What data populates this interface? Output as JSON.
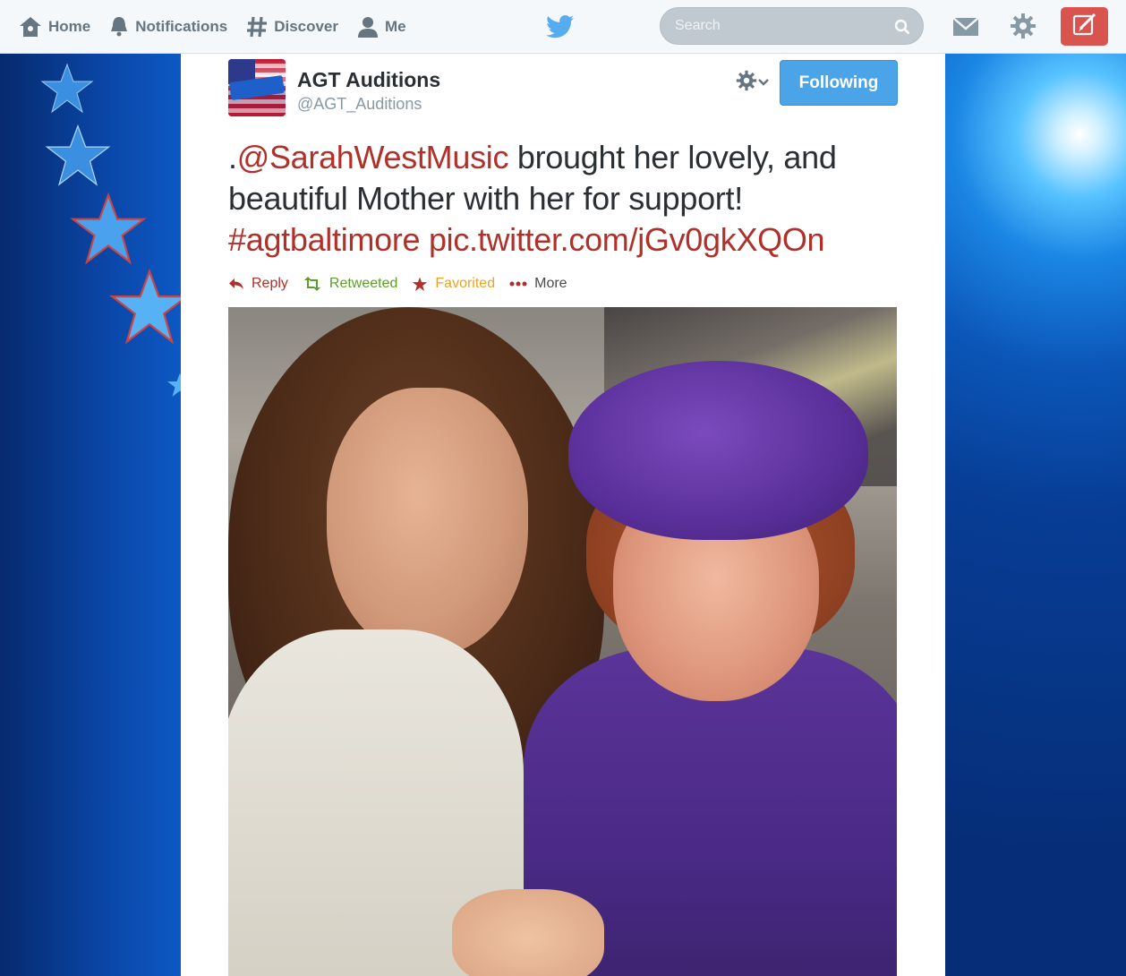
{
  "nav": {
    "home_label": "Home",
    "notifications_label": "Notifications",
    "discover_label": "Discover",
    "me_label": "Me"
  },
  "search": {
    "placeholder": "Search"
  },
  "tweet": {
    "name": "AGT Auditions",
    "handle": "@AGT_Auditions",
    "follow_label": "Following",
    "text_prefix": ".",
    "mention": "@SarahWestMusic",
    "text_body": " brought her lovely, and beautiful Mother with her for support! ",
    "hashtag": "#agtbaltimore",
    "pic_link": "pic.twitter.com/jGv0gkXQOn",
    "actions": {
      "reply": "Reply",
      "retweet": "Retweeted",
      "favorite": "Favorited",
      "more": "More"
    }
  },
  "colors": {
    "link": "#b0302a",
    "retweeted": "#5c9e2a",
    "favorited": "#e8a325",
    "follow_button": "#4ba3e8",
    "compose_button": "#d9534f"
  },
  "icons": [
    "home-icon",
    "bell-icon",
    "hashtag-icon",
    "person-icon",
    "twitter-bird-icon",
    "search-icon",
    "envelope-icon",
    "gear-icon",
    "compose-icon",
    "reply-icon",
    "retweet-icon",
    "star-icon",
    "ellipsis-icon"
  ]
}
